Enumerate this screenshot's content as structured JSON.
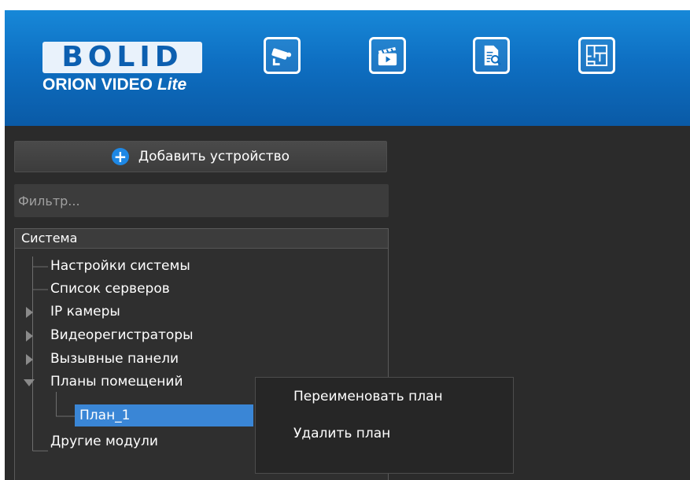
{
  "header": {
    "logo_text": "BOLID",
    "product_name": "ORION VIDEO",
    "product_edition": "Lite",
    "toolbar": [
      {
        "name": "cameras",
        "icon": "camera-icon"
      },
      {
        "name": "archive",
        "icon": "clapperboard-icon"
      },
      {
        "name": "log",
        "icon": "document-search-icon"
      },
      {
        "name": "plans",
        "icon": "floor-plan-icon"
      }
    ],
    "colors": {
      "header_blue": "#0e6fc2",
      "selection_blue": "#3a86d6",
      "panel_bg": "#2b2b2b"
    }
  },
  "panel": {
    "add_device_label": "Добавить устройство",
    "add_icon": "plus-circle-icon",
    "filter_placeholder": "Фильтр..."
  },
  "tree": {
    "header": "Система",
    "items": [
      {
        "label": "Настройки системы",
        "expander": "none"
      },
      {
        "label": "Список серверов",
        "expander": "none"
      },
      {
        "label": "IP камеры",
        "expander": "collapsed"
      },
      {
        "label": "Видеорегистраторы",
        "expander": "collapsed"
      },
      {
        "label": "Вызывные панели",
        "expander": "collapsed"
      },
      {
        "label": "Планы помещений",
        "expander": "expanded",
        "children": [
          {
            "label": "План_1",
            "selected": true
          }
        ]
      },
      {
        "label": "Другие модули",
        "expander": "none"
      }
    ]
  },
  "context_menu": {
    "items": [
      "Переименовать план",
      "Удалить план"
    ]
  }
}
